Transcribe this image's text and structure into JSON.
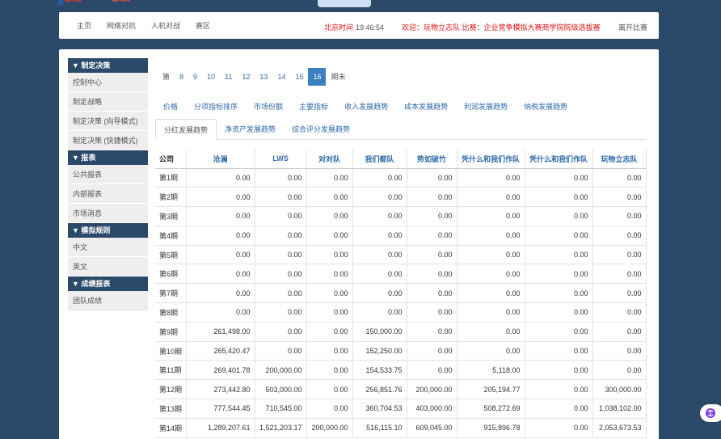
{
  "nav": {
    "items": [
      "主页",
      "网络对抗",
      "人机对战",
      "赛区"
    ],
    "clock_label": "北京时间",
    "clock_time": "19:46:54",
    "welcome": "欢迎：玩物立志队 比赛：企业竞争模拟大赛商学院院级选拔赛",
    "logout": "离开比赛"
  },
  "sidebar": {
    "sections": [
      {
        "title": "▼ 制定决策",
        "items": [
          "控制中心",
          "制定战略",
          "制定决策 (向导模式)",
          "制定决策 (快捷模式)"
        ]
      },
      {
        "title": "▼ 报表",
        "items": [
          "公共报表",
          "内部报表",
          "市场消息"
        ]
      },
      {
        "title": "▼ 模拟规则",
        "items": [
          "中文",
          "英文"
        ]
      },
      {
        "title": "▼ 成绩报表",
        "items": [
          "团队成绩"
        ]
      }
    ]
  },
  "pager": {
    "prefix": "第",
    "pages": [
      "8",
      "9",
      "10",
      "11",
      "12",
      "13",
      "14",
      "15",
      "16"
    ],
    "active": "16",
    "suffix": "期末"
  },
  "tabs_row1": [
    "价格",
    "分项指标排序",
    "市场份额",
    "主要指标",
    "收入发展趋势",
    "成本发展趋势",
    "利润发展趋势",
    "纳税发展趋势"
  ],
  "tabs_row2": [
    "分红发展趋势",
    "净资产发展趋势",
    "综合评分发展趋势"
  ],
  "tabs_row2_active": "分红发展趋势",
  "table": {
    "headers": [
      "公司",
      "沧澜",
      "LWS",
      "对对队",
      "我们都队",
      "势如破竹",
      "凭什么和我们作队",
      "凭什么和我们作队",
      "玩物立志队"
    ],
    "rows": [
      [
        "第1期",
        "0.00",
        "0.00",
        "0.00",
        "0.00",
        "0.00",
        "0.00",
        "0.00",
        "0.00"
      ],
      [
        "第2期",
        "0.00",
        "0.00",
        "0.00",
        "0.00",
        "0.00",
        "0.00",
        "0.00",
        "0.00"
      ],
      [
        "第3期",
        "0.00",
        "0.00",
        "0.00",
        "0.00",
        "0.00",
        "0.00",
        "0.00",
        "0.00"
      ],
      [
        "第4期",
        "0.00",
        "0.00",
        "0.00",
        "0.00",
        "0.00",
        "0.00",
        "0.00",
        "0.00"
      ],
      [
        "第5期",
        "0.00",
        "0.00",
        "0.00",
        "0.00",
        "0.00",
        "0.00",
        "0.00",
        "0.00"
      ],
      [
        "第6期",
        "0.00",
        "0.00",
        "0.00",
        "0.00",
        "0.00",
        "0.00",
        "0.00",
        "0.00"
      ],
      [
        "第7期",
        "0.00",
        "0.00",
        "0.00",
        "0.00",
        "0.00",
        "0.00",
        "0.00",
        "0.00"
      ],
      [
        "第8期",
        "0.00",
        "0.00",
        "0.00",
        "0.00",
        "0.00",
        "0.00",
        "0.00",
        "0.00"
      ],
      [
        "第9期",
        "261,498.00",
        "0.00",
        "0.00",
        "150,000.00",
        "0.00",
        "0.00",
        "0.00",
        "0.00"
      ],
      [
        "第10期",
        "265,420.47",
        "0.00",
        "0.00",
        "152,250.00",
        "0.00",
        "0.00",
        "0.00",
        "0.00"
      ],
      [
        "第11期",
        "269,401.78",
        "200,000.00",
        "0.00",
        "154,533.75",
        "0.00",
        "5,118.00",
        "0.00",
        "0.00"
      ],
      [
        "第12期",
        "273,442.80",
        "503,000.00",
        "0.00",
        "256,851.76",
        "200,000.00",
        "205,194.77",
        "0.00",
        "300,000.00"
      ],
      [
        "第13期",
        "777,544.45",
        "710,545.00",
        "0.00",
        "360,704.53",
        "403,000.00",
        "508,272.69",
        "0.00",
        "1,038,102.00"
      ],
      [
        "第14期",
        "1,289,207.61",
        "1,521,203.17",
        "200,000.00",
        "516,115.10",
        "609,045.00",
        "915,896.78",
        "0.00",
        "2,053,673.53"
      ]
    ]
  }
}
